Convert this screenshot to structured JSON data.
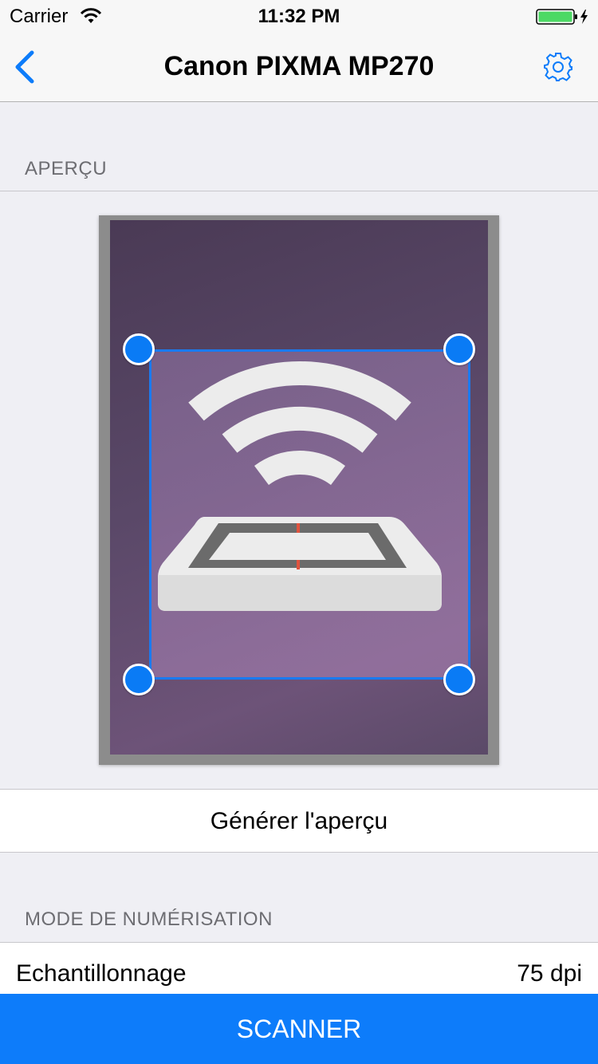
{
  "status_bar": {
    "carrier": "Carrier",
    "time": "11:32 PM"
  },
  "nav": {
    "title": "Canon PIXMA MP270",
    "back_icon": "chevron-left-icon",
    "settings_icon": "gear-icon"
  },
  "preview_section": {
    "header": "APERÇU",
    "generate_label": "Générer l'aperçu"
  },
  "scan_mode_section": {
    "header": "MODE DE NUMÉRISATION",
    "rows": [
      {
        "label": "Echantillonnage",
        "value": "75 dpi"
      }
    ]
  },
  "scan_button": {
    "label": "SCANNER"
  },
  "colors": {
    "accent": "#0d7cfa",
    "background": "#efeff4",
    "battery": "#4cd964"
  }
}
